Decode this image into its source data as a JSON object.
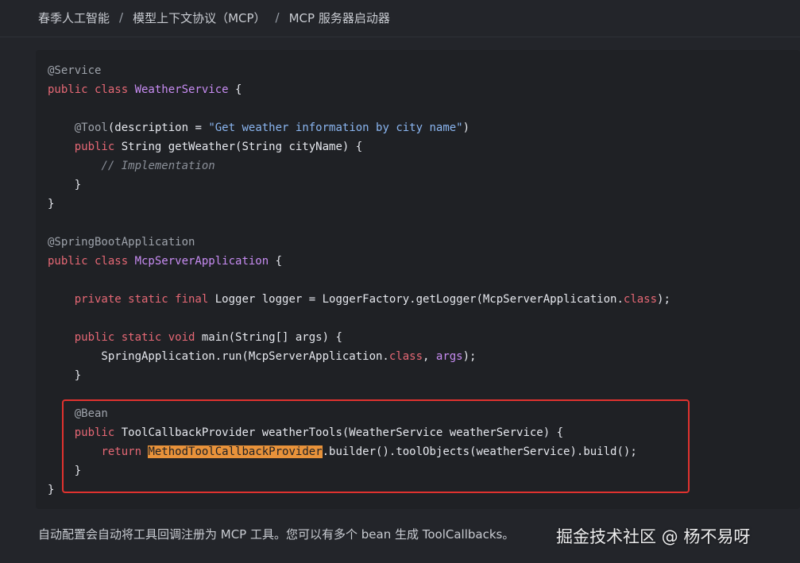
{
  "breadcrumb": {
    "items": [
      "春季人工智能",
      "模型上下文协议（MCP）",
      "MCP 服务器启动器"
    ],
    "separator": "/"
  },
  "code": {
    "lines": [
      [
        {
          "t": "@Service",
          "c": "ann"
        }
      ],
      [
        {
          "t": "public class ",
          "c": "kw"
        },
        {
          "t": "WeatherService",
          "c": "cls"
        },
        {
          "t": " {",
          "c": "plain"
        }
      ],
      [],
      [
        {
          "t": "    ",
          "c": "plain"
        },
        {
          "t": "@Tool",
          "c": "ann"
        },
        {
          "t": "(description = ",
          "c": "plain"
        },
        {
          "t": "\"Get weather information by city name\"",
          "c": "str"
        },
        {
          "t": ")",
          "c": "plain"
        }
      ],
      [
        {
          "t": "    ",
          "c": "plain"
        },
        {
          "t": "public",
          "c": "kw"
        },
        {
          "t": " String getWeather(String cityName) {",
          "c": "plain"
        }
      ],
      [
        {
          "t": "        ",
          "c": "plain"
        },
        {
          "t": "// Implementation",
          "c": "cmt"
        }
      ],
      [
        {
          "t": "    }",
          "c": "plain"
        }
      ],
      [
        {
          "t": "}",
          "c": "plain"
        }
      ],
      [],
      [
        {
          "t": "@SpringBootApplication",
          "c": "ann"
        }
      ],
      [
        {
          "t": "public class ",
          "c": "kw"
        },
        {
          "t": "McpServerApplication",
          "c": "cls"
        },
        {
          "t": " {",
          "c": "plain"
        }
      ],
      [],
      [
        {
          "t": "    ",
          "c": "plain"
        },
        {
          "t": "private static final",
          "c": "kw"
        },
        {
          "t": " Logger logger = LoggerFactory.getLogger(McpServerApplication.",
          "c": "plain"
        },
        {
          "t": "class",
          "c": "kw"
        },
        {
          "t": ");",
          "c": "plain"
        }
      ],
      [],
      [
        {
          "t": "    ",
          "c": "plain"
        },
        {
          "t": "public static void",
          "c": "kw"
        },
        {
          "t": " main(String[] args) {",
          "c": "plain"
        }
      ],
      [
        {
          "t": "        SpringApplication.run(McpServerApplication.",
          "c": "plain"
        },
        {
          "t": "class",
          "c": "kw"
        },
        {
          "t": ", ",
          "c": "plain"
        },
        {
          "t": "args",
          "c": "arg"
        },
        {
          "t": ");",
          "c": "plain"
        }
      ],
      [
        {
          "t": "    }",
          "c": "plain"
        }
      ],
      [],
      [
        {
          "t": "    ",
          "c": "plain"
        },
        {
          "t": "@Bean",
          "c": "ann"
        }
      ],
      [
        {
          "t": "    ",
          "c": "plain"
        },
        {
          "t": "public",
          "c": "kw"
        },
        {
          "t": " ToolCallbackProvider weatherTools(WeatherService weatherService) {",
          "c": "plain"
        }
      ],
      [
        {
          "t": "        ",
          "c": "plain"
        },
        {
          "t": "return",
          "c": "kw"
        },
        {
          "t": " ",
          "c": "plain"
        },
        {
          "t": "MethodToolCallbackProvider",
          "c": "hl"
        },
        {
          "t": ".builder().toolObjects(weatherService).build();",
          "c": "plain"
        }
      ],
      [
        {
          "t": "    }",
          "c": "plain"
        }
      ],
      [
        {
          "t": "}",
          "c": "plain"
        }
      ]
    ]
  },
  "footer": {
    "text": "自动配置会自动将工具回调注册为 MCP 工具。您可以有多个 bean 生成 ToolCallbacks。"
  },
  "watermark": {
    "text": "掘金技术社区 @ 杨不易呀"
  },
  "colors": {
    "background": "#23252a",
    "code_background": "#1f2125",
    "keyword": "#e66875",
    "class_name": "#c78cf2",
    "annotation": "#9ea3ab",
    "string": "#8ab5f0",
    "highlight": "#e8923a",
    "highlight_box_border": "#e0322f"
  }
}
